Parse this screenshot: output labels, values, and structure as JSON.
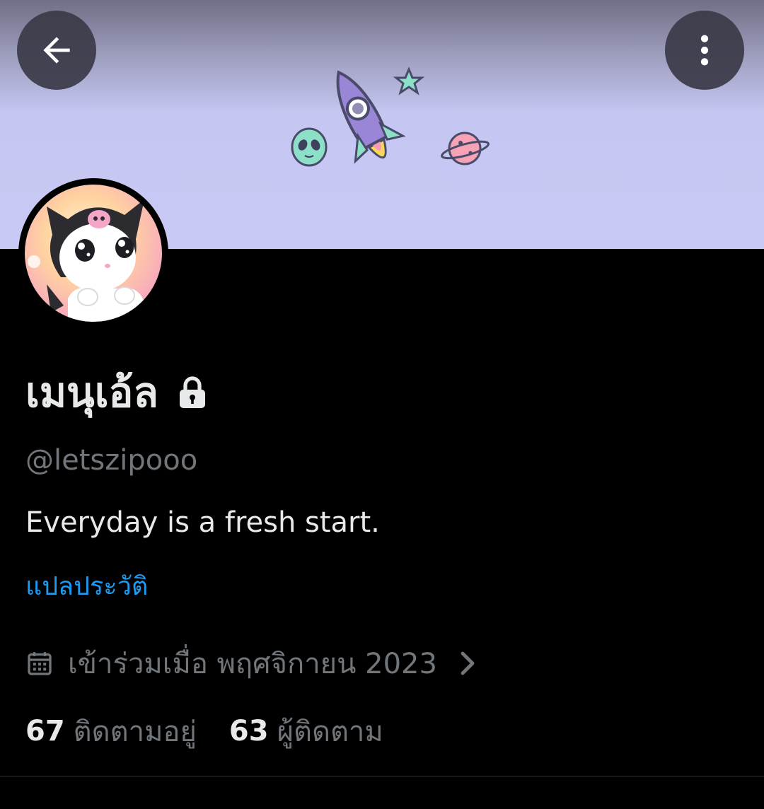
{
  "header": {
    "back_icon": "arrow-left-icon",
    "more_icon": "vertical-dots-icon",
    "banner_colors": {
      "top": "#6f6f86",
      "bottom": "#c8c9f4"
    }
  },
  "profile": {
    "display_name": "เมนุเอ้ล",
    "protected_icon": "lock-icon",
    "handle": "@letszipooo",
    "bio": "Everyday is a fresh start.",
    "translate_bio_label": "แปลประวัติ",
    "joined_text": "เข้าร่วมเมื่อ พฤศจิกายน 2023",
    "joined_icon": "calendar-icon",
    "joined_chevron": "chevron-right-icon"
  },
  "stats": {
    "following_count": "67",
    "following_label": "ติดตามอยู่",
    "followers_count": "63",
    "followers_label": "ผู้ติดตาม"
  },
  "colors": {
    "background": "#000000",
    "primary_text": "#e7e9ea",
    "secondary_text": "#71767b",
    "link": "#1d9bf0"
  }
}
